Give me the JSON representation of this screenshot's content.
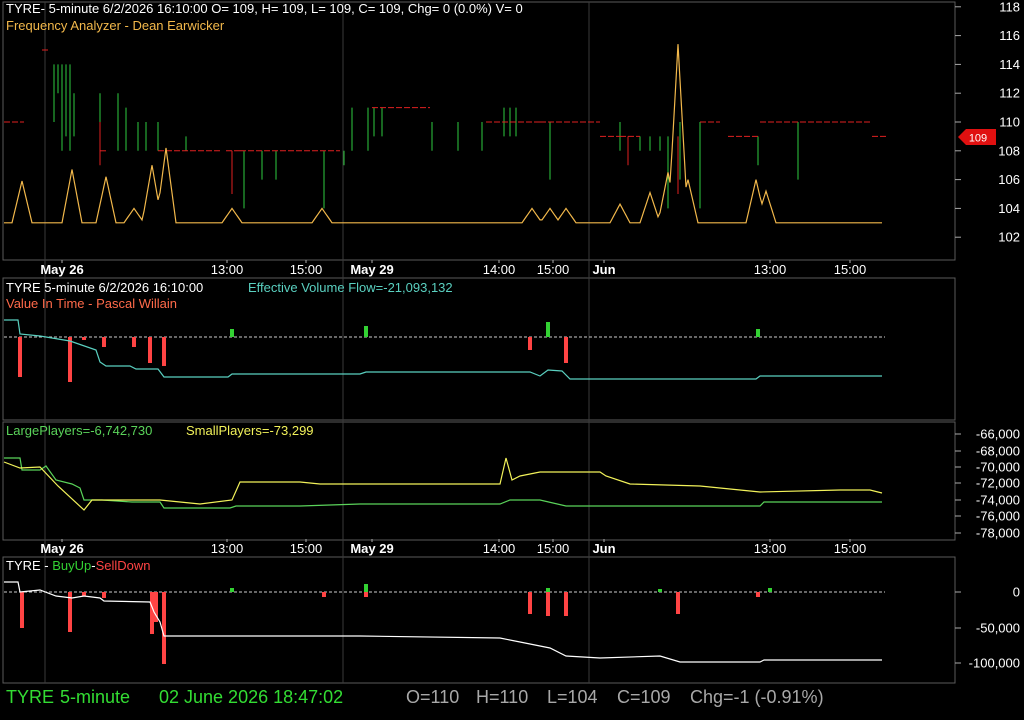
{
  "colors": {
    "background": "#000000",
    "grid": "#3a3a3a",
    "border": "#5a5a5a",
    "price_up": "#2ecc40",
    "price_down": "#e02020",
    "frequency_line": "#f2b84b",
    "evf_line": "#5ad0c0",
    "value_in_time_label": "#ff6a4a",
    "large_players": "#5ad35a",
    "small_players": "#f2f25a",
    "buy_up": "#33d133",
    "sell_down": "#ff4444",
    "accumulation_line": "#ffffff",
    "price_marker": "#e01010",
    "axis_text": "#ffffff",
    "status_green": "#33dd33",
    "status_gray": "#a8a8a8"
  },
  "panel1": {
    "header": "TYRE- 5-minute 6/2/2026 16:10:00 O= 109, H= 109, L= 109, C= 109, Chg= 0 (0.0%) V= 0",
    "indicator_label": "Frequency Analyzer - Dean Earwicker",
    "y_ticks": [
      "118",
      "116",
      "114",
      "112",
      "110",
      "108",
      "106",
      "104",
      "102"
    ],
    "price_marker": "109"
  },
  "time_axis": {
    "labels": [
      "May 26",
      "13:00",
      "15:00",
      "May 29",
      "14:00",
      "15:00",
      "Jun",
      "13:00",
      "15:00"
    ]
  },
  "panel2": {
    "header": "TYRE 5-minute  6/2/2026 16:10:00",
    "evf_label": "Effective Volume Flow=-21,093,132",
    "indicator_label": "Value In Time - Pascal Willain"
  },
  "panel3": {
    "large_label": "LargePlayers=-6,742,730",
    "small_label": "SmallPlayers=-73,299",
    "y_ticks": [
      "-66,000",
      "-68,000",
      "-70,000",
      "-72,000",
      "-74,000",
      "-76,000",
      "-78,000"
    ]
  },
  "panel4": {
    "ticker": "TYRE - ",
    "buy_label": "BuyUp",
    "dash": "-",
    "sell_label": "SellDown",
    "y_ticks": [
      "0",
      "-50,000",
      "-100,000"
    ]
  },
  "status_bar": {
    "symbol": "TYRE",
    "interval": "5-minute",
    "datetime": "02 June 2026 18:47:02",
    "open": "O=110",
    "high": "H=110",
    "low": "L=104",
    "close": "C=109",
    "change": "Chg=-1 (-0.91%)"
  }
}
